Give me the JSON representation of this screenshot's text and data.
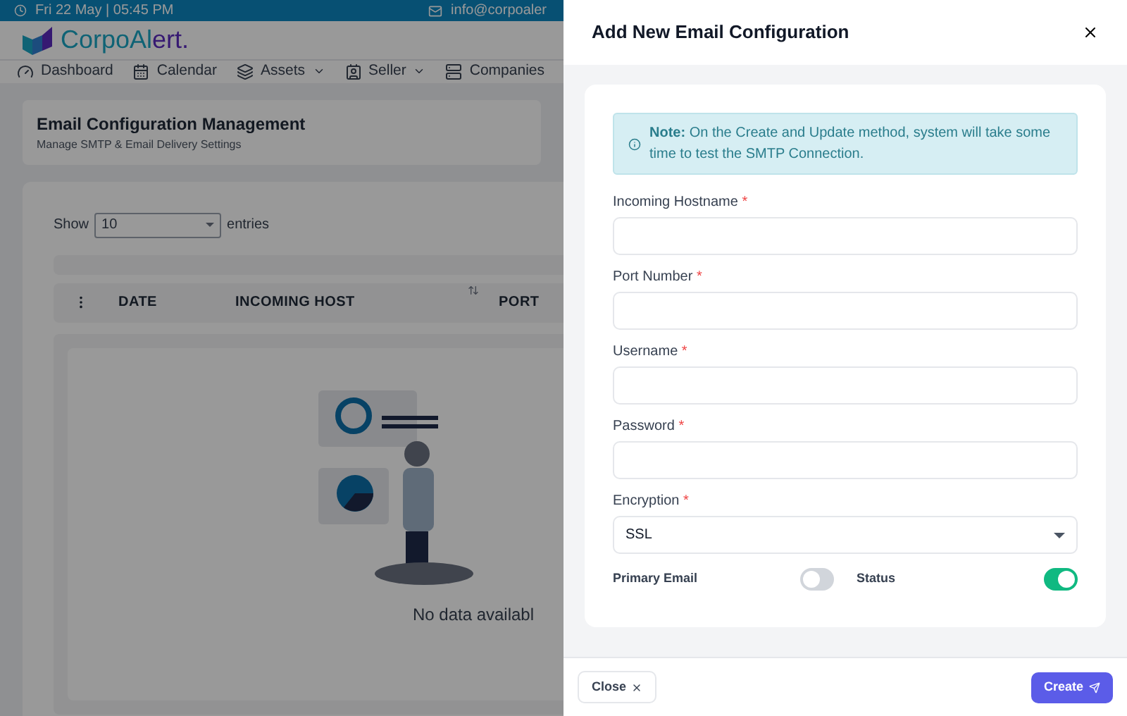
{
  "top_bar": {
    "datetime": "Fri 22 May | 05:45 PM",
    "email": "info@corpoaler"
  },
  "logo": {
    "part_1": "CorpoAl",
    "part_2": "ert."
  },
  "nav": [
    {
      "label": "Dashboard",
      "dropdown": false
    },
    {
      "label": "Calendar",
      "dropdown": false
    },
    {
      "label": "Assets",
      "dropdown": true
    },
    {
      "label": "Seller",
      "dropdown": true
    },
    {
      "label": "Companies",
      "dropdown": false
    }
  ],
  "page_header": {
    "title": "Email Configuration Management",
    "subtitle": "Manage SMTP & Email Delivery Settings"
  },
  "table": {
    "show_label": "Show",
    "page_size": "10",
    "entries_label": "entries",
    "columns": [
      "DATE",
      "INCOMING HOST",
      "PORT"
    ],
    "empty_message": "No data availabl"
  },
  "drawer": {
    "title": "Add New Email Configuration",
    "note": "**Note:** On the Create and Update method, system will take some time to test the SMTP Connection.",
    "fields": [
      {
        "label": "Incoming Hostname",
        "required_mark": "*",
        "kind": "input"
      },
      {
        "label": "Port Number",
        "required_mark": "*",
        "kind": "input"
      },
      {
        "label": "Username",
        "required_mark": "*",
        "kind": "input"
      },
      {
        "label": "Password",
        "required_mark": "*",
        "kind": "input"
      },
      {
        "label": "Encryption",
        "required_mark": "*",
        "kind": "select",
        "value": "SSL"
      }
    ],
    "toggles": [
      {
        "label": "Primary Email",
        "on": false
      },
      {
        "label": "Status",
        "on": true
      }
    ],
    "close_button": "Close",
    "create_button": "Create"
  }
}
